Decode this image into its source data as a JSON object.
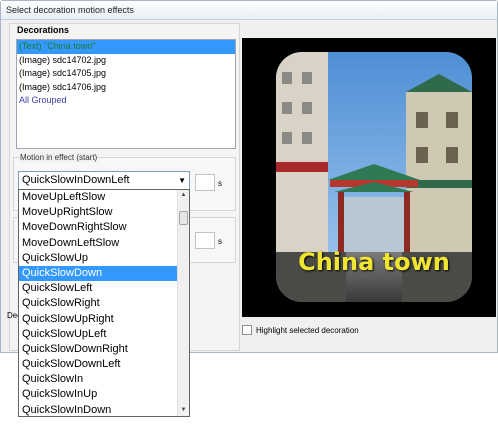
{
  "window": {
    "title": "Select decoration motion effects"
  },
  "decorations": {
    "heading": "Decorations",
    "items": [
      {
        "label": "(Text) \"China town\""
      },
      {
        "label": "(Image) sdc14702.jpg"
      },
      {
        "label": "(Image) sdc14705.jpg"
      },
      {
        "label": "(Image) sdc14706.jpg"
      },
      {
        "label": "All Grouped"
      }
    ],
    "selected_index": 0
  },
  "motion_start": {
    "label": "Motion in effect (start)",
    "selected": "QuickSlowInDownLeft",
    "unit": "s"
  },
  "motion_end": {
    "unit": "s"
  },
  "cutoff_label": "Dec",
  "dropdown": {
    "options": [
      "MoveUpLeftSlow",
      "MoveUpRightSlow",
      "MoveDownRightSlow",
      "MoveDownLeftSlow",
      "QuickSlowUp",
      "QuickSlowDown",
      "QuickSlowLeft",
      "QuickSlowRight",
      "QuickSlowUpRight",
      "QuickSlowUpLeft",
      "QuickSlowDownRight",
      "QuickSlowDownLeft",
      "QuickSlowIn",
      "QuickSlowInUp",
      "QuickSlowInDown"
    ],
    "highlighted_index": 5
  },
  "preview": {
    "overlay_text": "China town"
  },
  "highlight_checkbox": {
    "label": "Highlight selected decoration",
    "checked": false
  },
  "colors": {
    "selection": "#3399ff",
    "overlay_text": "#f0e531"
  }
}
